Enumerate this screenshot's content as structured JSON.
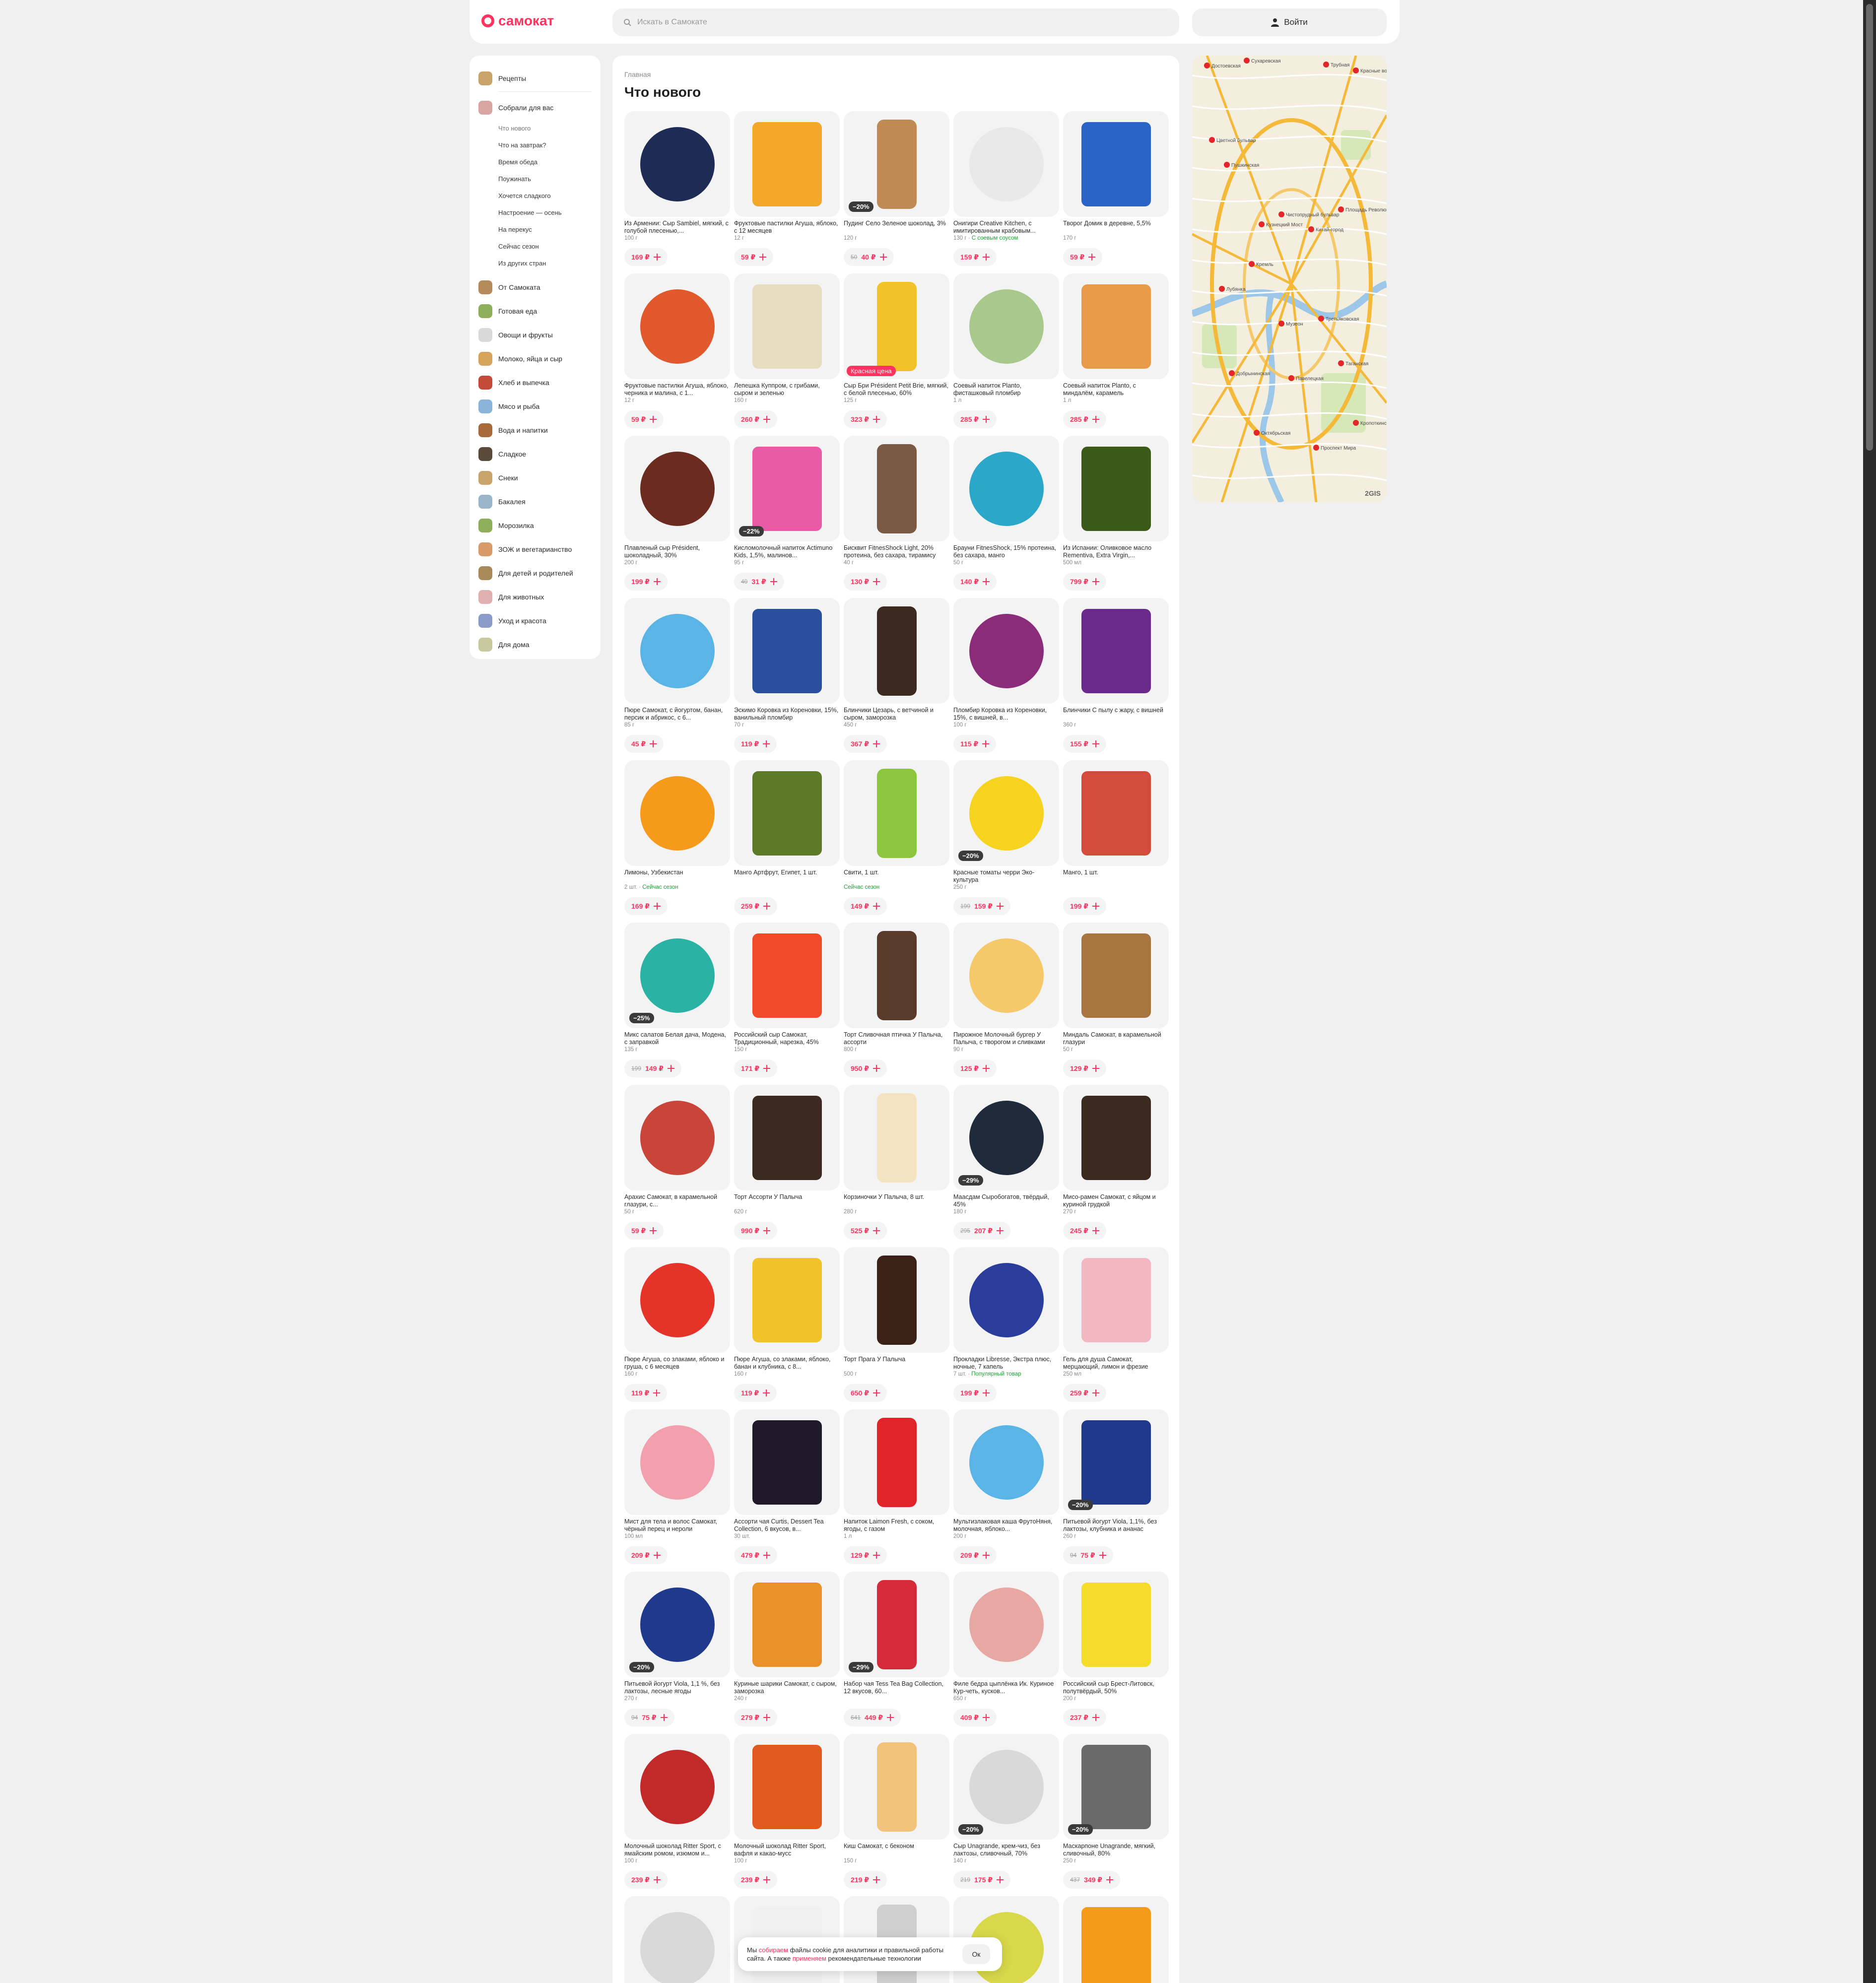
{
  "header": {
    "logo_text": "самокат",
    "search_placeholder": "Искать в Самокате",
    "login_label": "Войти",
    "brand_color": "#ff335f"
  },
  "sidebar": {
    "top_items": [
      {
        "label": "Рецепты",
        "icon": "recipes-thumb"
      },
      {
        "label": "Собрали для вас",
        "icon": "collections-thumb"
      }
    ],
    "sub_items": [
      "Что нового",
      "Что на завтрак?",
      "Время обеда",
      "Поужинать",
      "Хочется сладкого",
      "Настроение — осень",
      "На перекус",
      "Сейчас сезон",
      "Из других стран"
    ],
    "categories": [
      "От Самоката",
      "Готовая еда",
      "Овощи и фрукты",
      "Молоко, яйца и сыр",
      "Хлеб и выпечка",
      "Мясо и рыба",
      "Вода и напитки",
      "Сладкое",
      "Снеки",
      "Бакалея",
      "Морозилка",
      "ЗОЖ и вегетарианство",
      "Для детей и родителей",
      "Для животных",
      "Уход и красота",
      "Для дома"
    ]
  },
  "main": {
    "breadcrumb": "Главная",
    "title": "Что нового"
  },
  "products": [
    {
      "name": "Из Армении: Сыр Sambiel, мягкий, с голубой плесенью,...",
      "weight": "100 г",
      "tag": "",
      "price": "169 ₽",
      "old": "",
      "badge": "",
      "color": "#1d2b55"
    },
    {
      "name": "Фруктовые пастилки Агуша, яблоко, с 12 месяцев",
      "weight": "12 г",
      "tag": "",
      "price": "59 ₽",
      "old": "",
      "badge": "",
      "color": "#f3a82a"
    },
    {
      "name": "Пудинг Село Зеленое шоколад, 3%",
      "weight": "120 г",
      "tag": "",
      "price": "40 ₽",
      "old": "50",
      "badge": "−20%",
      "color": "#c08a55"
    },
    {
      "name": "Онигири Creative Kitchen, с имитированным крабовым...",
      "weight": "130 г",
      "tag": "С соевым соусом",
      "price": "159 ₽",
      "old": "",
      "badge": "",
      "color": "#e9e9e9"
    },
    {
      "name": "Творог Домик в деревне, 5,5%",
      "weight": "170 г",
      "tag": "",
      "price": "59 ₽",
      "old": "",
      "badge": "",
      "color": "#2a64c4"
    },
    {
      "name": "Фруктовые пастилки Агуша, яблоко, черника и малина, с 1...",
      "weight": "12 г",
      "tag": "",
      "price": "59 ₽",
      "old": "",
      "badge": "",
      "color": "#e0582b"
    },
    {
      "name": "Лепешка Куппром, с грибами, сыром и зеленью",
      "weight": "160 г",
      "tag": "",
      "price": "260 ₽",
      "old": "",
      "badge": "",
      "color": "#e8dcc1"
    },
    {
      "name": "Сыр Бри Président Petit Brie, мягкий, с белой плесенью, 60%",
      "weight": "125 г",
      "tag": "",
      "price": "323 ₽",
      "old": "",
      "badge": "Красная цена",
      "color": "#f2c22b"
    },
    {
      "name": "Соевый напиток Planto, фисташковый пломбир",
      "weight": "1 л",
      "tag": "",
      "price": "285 ₽",
      "old": "",
      "badge": "",
      "color": "#a9c98c"
    },
    {
      "name": "Соевый напиток Planto, с миндалём, карамель",
      "weight": "1 л",
      "tag": "",
      "price": "285 ₽",
      "old": "",
      "badge": "",
      "color": "#e79b4b"
    },
    {
      "name": "Плавленый сыр Président, шоколадный, 30%",
      "weight": "200 г",
      "tag": "",
      "price": "199 ₽",
      "old": "",
      "badge": "",
      "color": "#6b2b1f"
    },
    {
      "name": "Кисломолочный напиток Actimuno Kids, 1,5%, малинов...",
      "weight": "95 г",
      "tag": "",
      "price": "31 ₽",
      "old": "40",
      "badge": "−22%",
      "color": "#e95aa4"
    },
    {
      "name": "Бисквит FitnesShock Light, 20% протеина, без сахара, тирамису",
      "weight": "40 г",
      "tag": "",
      "price": "130 ₽",
      "old": "",
      "badge": "",
      "color": "#7a5a45"
    },
    {
      "name": "Брауни FitnesShock, 15% протеина, без сахара, манго",
      "weight": "50 г",
      "tag": "",
      "price": "140 ₽",
      "old": "",
      "badge": "",
      "color": "#2aa7c9"
    },
    {
      "name": "Из Испании: Оливковое масло Rementiva, Extra Virgin,...",
      "weight": "500 мл",
      "tag": "",
      "price": "799 ₽",
      "old": "",
      "badge": "",
      "color": "#3b5a1a"
    },
    {
      "name": "Пюре Самокат, с йогуртом, банан, персик и абрикос, с 6...",
      "weight": "85 г",
      "tag": "",
      "price": "45 ₽",
      "old": "",
      "badge": "",
      "color": "#5ab4e5"
    },
    {
      "name": "Эскимо Коровка из Кореновки, 15%, ванильный пломбир",
      "weight": "70 г",
      "tag": "",
      "price": "119 ₽",
      "old": "",
      "badge": "",
      "color": "#2a4f9c"
    },
    {
      "name": "Блинчики Цезарь, с ветчиной и сыром, заморозка",
      "weight": "450 г",
      "tag": "",
      "price": "367 ₽",
      "old": "",
      "badge": "",
      "color": "#3a2a1f"
    },
    {
      "name": "Пломбир Коровка из Кореновки, 15%, с вишней, в...",
      "weight": "100 г",
      "tag": "",
      "price": "115 ₽",
      "old": "",
      "badge": "",
      "color": "#8b2c7a"
    },
    {
      "name": "Блинчики С пылу с жару, с вишней",
      "weight": "360 г",
      "tag": "",
      "price": "155 ₽",
      "old": "",
      "badge": "",
      "color": "#6a2a8c"
    },
    {
      "name": "Лимоны, Узбекистан",
      "weight": "2 шт.",
      "tag": "Сейчас сезон",
      "price": "169 ₽",
      "old": "",
      "badge": "",
      "color": "#f59a1b"
    },
    {
      "name": "Манго Артфрут, Египет, 1 шт.",
      "weight": "",
      "tag": "",
      "price": "259 ₽",
      "old": "",
      "badge": "",
      "color": "#5d7a2a"
    },
    {
      "name": "Свити, 1 шт.",
      "weight": "",
      "tag": "Сейчас сезон",
      "price": "149 ₽",
      "old": "",
      "badge": "",
      "color": "#8cc63f"
    },
    {
      "name": "Красные томаты черри Эко-культура",
      "weight": "250 г",
      "tag": "",
      "price": "159 ₽",
      "old": "199",
      "badge": "−20%",
      "color": "#f5d31f"
    },
    {
      "name": "Манго, 1 шт.",
      "weight": "",
      "tag": "",
      "price": "199 ₽",
      "old": "",
      "badge": "",
      "color": "#d34b3a"
    },
    {
      "name": "Микс салатов Белая дача, Модена, с заправкой",
      "weight": "135 г",
      "tag": "",
      "price": "149 ₽",
      "old": "199",
      "badge": "−25%",
      "color": "#2ab3a5"
    },
    {
      "name": "Российский сыр Самокат, Традиционный, нарезка, 45%",
      "weight": "150 г",
      "tag": "",
      "price": "171 ₽",
      "old": "",
      "badge": "",
      "color": "#f04a2a"
    },
    {
      "name": "Торт Сливочная птичка У Палыча, ассорти",
      "weight": "800 г",
      "tag": "",
      "price": "950 ₽",
      "old": "",
      "badge": "",
      "color": "#5a3a2a"
    },
    {
      "name": "Пирожное Молочный бургер У Палыча, с творогом и сливками",
      "weight": "90 г",
      "tag": "",
      "price": "125 ₽",
      "old": "",
      "badge": "",
      "color": "#f5c86a"
    },
    {
      "name": "Миндаль Самокат, в карамельной глазури",
      "weight": "50 г",
      "tag": "",
      "price": "129 ₽",
      "old": "",
      "badge": "",
      "color": "#a8743f"
    },
    {
      "name": "Арахис Самокат, в карамельной глазури, с...",
      "weight": "50 г",
      "tag": "",
      "price": "59 ₽",
      "old": "",
      "badge": "",
      "color": "#c9453a"
    },
    {
      "name": "Торт Ассорти У Палыча",
      "weight": "620 г",
      "tag": "",
      "price": "990 ₽",
      "old": "",
      "badge": "",
      "color": "#3a2a1f"
    },
    {
      "name": "Корзиночки У Палыча, 8 шт.",
      "weight": "280 г",
      "tag": "",
      "price": "525 ₽",
      "old": "",
      "badge": "",
      "color": "#f3e3c0"
    },
    {
      "name": "Маасдам Сыробогатов, твёрдый, 45%",
      "weight": "180 г",
      "tag": "",
      "price": "207 ₽",
      "old": "295",
      "badge": "−29%",
      "color": "#1f2a3a"
    },
    {
      "name": "Мисо-рамен Самокат, с яйцом и куриной грудкой",
      "weight": "270 г",
      "tag": "",
      "price": "245 ₽",
      "old": "",
      "badge": "",
      "color": "#3a2a1f"
    },
    {
      "name": "Пюре Агуша, со злаками, яблоко и груша, с 6 месяцев",
      "weight": "160 г",
      "tag": "",
      "price": "119 ₽",
      "old": "",
      "badge": "",
      "color": "#e6332a"
    },
    {
      "name": "Пюре Агуша, со злаками, яблоко, банан и клубника, с 8...",
      "weight": "160 г",
      "tag": "",
      "price": "119 ₽",
      "old": "",
      "badge": "",
      "color": "#f2c22b"
    },
    {
      "name": "Торт Прага У Палыча",
      "weight": "500 г",
      "tag": "",
      "price": "650 ₽",
      "old": "",
      "badge": "",
      "color": "#3a2218"
    },
    {
      "name": "Прокладки Libresse, Экстра плюс, ночные, 7 капель",
      "weight": "7 шт.",
      "tag": "Популярный товар",
      "price": "199 ₽",
      "old": "",
      "badge": "",
      "color": "#2b3d9c"
    },
    {
      "name": "Гель для душа Самокат, мерцающий, лимон и фрезие",
      "weight": "250 мл",
      "tag": "",
      "price": "259 ₽",
      "old": "",
      "badge": "",
      "color": "#f3b7c2"
    },
    {
      "name": "Мист для тела и волос Самокат, чёрный перец и нероли",
      "weight": "100 мл",
      "tag": "",
      "price": "209 ₽",
      "old": "",
      "badge": "",
      "color": "#f2a0ae"
    },
    {
      "name": "Ассорти чая Curtis, Dessert Tea Collection, 6 вкусов, в...",
      "weight": "30 шт.",
      "tag": "",
      "price": "479 ₽",
      "old": "",
      "badge": "",
      "color": "#1f1a2a"
    },
    {
      "name": "Напиток Laimon Fresh, с соком, ягоды, с газом",
      "weight": "1 л",
      "tag": "",
      "price": "129 ₽",
      "old": "",
      "badge": "",
      "color": "#e0242a"
    },
    {
      "name": "Мультизлаковая каша ФрутоНяня, молочная, яблоко...",
      "weight": "200 г",
      "tag": "",
      "price": "209 ₽",
      "old": "",
      "badge": "",
      "color": "#5ab4e5"
    },
    {
      "name": "Питьевой йогурт Viola, 1,1%, без лактозы, клубника и ананас",
      "weight": "260 г",
      "tag": "",
      "price": "75 ₽",
      "old": "94",
      "badge": "−20%",
      "color": "#1f3a8c"
    },
    {
      "name": "Питьевой йогурт Viola, 1,1 %, без лактозы, лесные ягоды",
      "weight": "270 г",
      "tag": "",
      "price": "75 ₽",
      "old": "94",
      "badge": "−20%",
      "color": "#1f3a8c"
    },
    {
      "name": "Куриные шарики Самокат, с сыром, заморозка",
      "weight": "240 г",
      "tag": "",
      "price": "279 ₽",
      "old": "",
      "badge": "",
      "color": "#e8912a"
    },
    {
      "name": "Набор чая Tess Tea Bag Collection, 12 вкусов, 60...",
      "weight": "",
      "tag": "",
      "price": "449 ₽",
      "old": "641",
      "badge": "−29%",
      "color": "#d42a3a"
    },
    {
      "name": "Филе бедра цыплёнка Ик. Куриное Кур-четь, кусков...",
      "weight": "650 г",
      "tag": "",
      "price": "409 ₽",
      "old": "",
      "badge": "",
      "color": "#e7a7a3"
    },
    {
      "name": "Российский сыр Брест-Литовск, полутвёрдый, 50%",
      "weight": "200 г",
      "tag": "",
      "price": "237 ₽",
      "old": "",
      "badge": "",
      "color": "#f5dc2a"
    },
    {
      "name": "Молочный шоколад Ritter Sport, с ямайским ромом, изюмом и...",
      "weight": "100 г",
      "tag": "",
      "price": "239 ₽",
      "old": "",
      "badge": "",
      "color": "#c22a2a"
    },
    {
      "name": "Молочный шоколад Ritter Sport, вафля и какао-мусс",
      "weight": "100 г",
      "tag": "",
      "price": "239 ₽",
      "old": "",
      "badge": "",
      "color": "#e25a1f"
    },
    {
      "name": "Киш Самокат, с беконом",
      "weight": "150 г",
      "tag": "",
      "price": "219 ₽",
      "old": "",
      "badge": "",
      "color": "#f2c27a"
    },
    {
      "name": "Сыр Unagrande, крем-чиз, без лактозы, сливочный, 70%",
      "weight": "140 г",
      "tag": "",
      "price": "175 ₽",
      "old": "219",
      "badge": "−20%",
      "color": "#d9d9d9"
    },
    {
      "name": "Маскарпоне Unagrande, мягкий, сливочный, 80%",
      "weight": "250 г",
      "tag": "",
      "price": "349 ₽",
      "old": "437",
      "badge": "−20%",
      "color": "#6a6a6a"
    },
    {
      "name": "",
      "weight": "",
      "tag": "",
      "price": "",
      "old": "",
      "badge": "",
      "color": "#d9d9d9"
    },
    {
      "name": "",
      "weight": "",
      "tag": "",
      "price": "",
      "old": "",
      "badge": "",
      "color": "#f0f0f0"
    },
    {
      "name": "",
      "weight": "",
      "tag": "",
      "price": "",
      "old": "",
      "badge": "",
      "color": "#cfcfcf"
    },
    {
      "name": "",
      "weight": "",
      "tag": "",
      "price": "",
      "old": "",
      "badge": "",
      "color": "#d9d84a"
    },
    {
      "name": "",
      "weight": "",
      "tag": "",
      "price": "",
      "old": "",
      "badge": "",
      "color": "#f59a1b"
    }
  ],
  "map": {
    "credit": "2GIS",
    "labels": [
      "Достоевская",
      "Сухаревская",
      "Трубная",
      "Красные ворота",
      "Цветной бульвар",
      "Пушкинская",
      "Кузнецкий Мост",
      "Чистопрудный бульвар",
      "Китай-город",
      "Площадь Революции",
      "Кремль",
      "Лубянка",
      "Музеон",
      "Третьяковская",
      "Добрынинская",
      "Павелецкая",
      "Таганская",
      "Октябрьская",
      "Проспект Мира",
      "Кропоткинская"
    ]
  },
  "cookie": {
    "text_before": "Мы ",
    "link1": "собираем",
    "text_mid": " файлы cookie для аналитики и правильной работы сайта. А также ",
    "link2": "применяем",
    "text_after": " рекомендательные технологии",
    "ok_label": "Ок"
  }
}
